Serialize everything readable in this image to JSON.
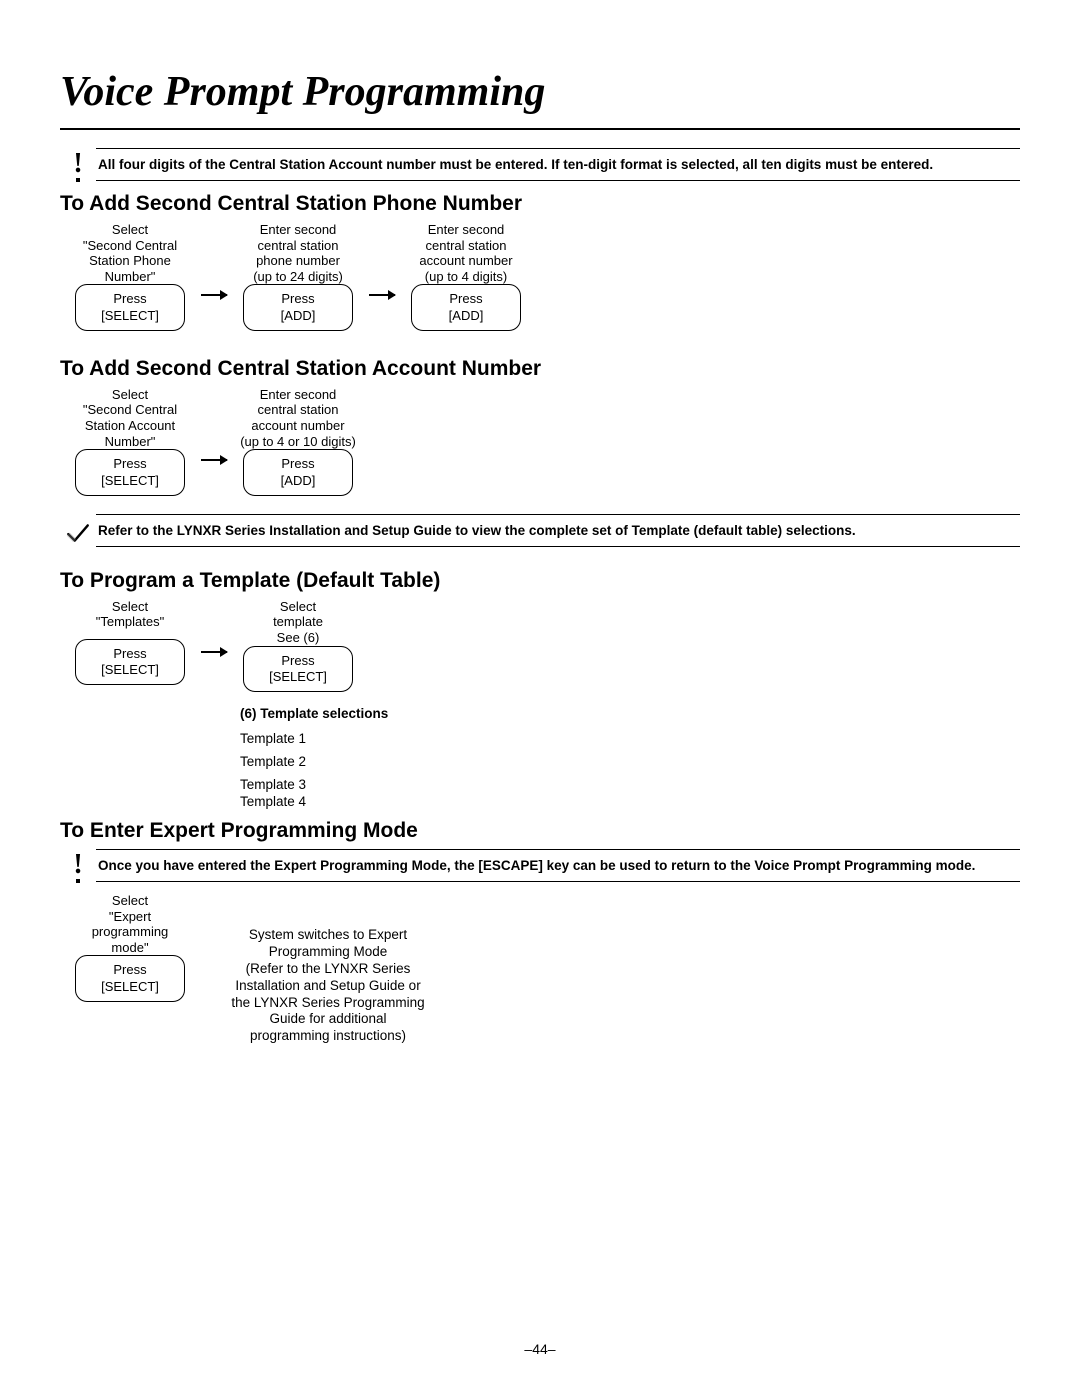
{
  "title": "Voice Prompt Programming",
  "callouts": {
    "top": "All four digits of the Central Station Account number must be entered. If ten-digit format is selected, all ten digits must be entered.",
    "lynx": "Refer to the LYNXR Series Installation and Setup Guide to view the complete set of Template (default table) selections.",
    "expert": "Once you have entered the Expert Programming Mode, the [ESCAPE] key can be used to return to the Voice Prompt Programming mode."
  },
  "sections": {
    "phone": {
      "heading": "To Add Second Central Station Phone Number",
      "steps": [
        {
          "label": "Select\n\"Second Central\nStation Phone\nNumber\"",
          "box": "Press\n[SELECT]"
        },
        {
          "label": "Enter second\ncentral station\nphone number\n(up to 24 digits)",
          "box": "Press\n[ADD]"
        },
        {
          "label": "Enter second\ncentral station\naccount number\n(up to 4 digits)",
          "box": "Press\n[ADD]"
        }
      ]
    },
    "account": {
      "heading": "To Add Second Central Station Account Number",
      "steps": [
        {
          "label": "Select\n\"Second Central\nStation Account\nNumber\"",
          "box": "Press\n[SELECT]"
        },
        {
          "label": "Enter second\ncentral station\naccount number\n(up to 4 or 10 digits)",
          "box": "Press\n[ADD]"
        }
      ]
    },
    "template": {
      "heading": "To Program a Template (Default Table)",
      "steps": [
        {
          "label": "Select\n\"Templates\"",
          "box": "Press\n[SELECT]"
        },
        {
          "label": "Select\ntemplate\nSee (6)",
          "box": "Press\n[SELECT]"
        }
      ],
      "sel_head": "(6) Template selections",
      "items": [
        "Template 1",
        "Template 2",
        "Template 3",
        "Template 4"
      ]
    },
    "expert": {
      "heading": "To Enter Expert Programming Mode",
      "left_label": "Select\n\"Expert\nprogramming\nmode\"",
      "left_box": "Press\n[SELECT]",
      "right": "System switches to Expert Programming Mode\n(Refer to the LYNXR Series Installation and Setup Guide or the LYNXR Series Programming Guide for additional programming instructions)"
    }
  },
  "page_num": "–44–"
}
